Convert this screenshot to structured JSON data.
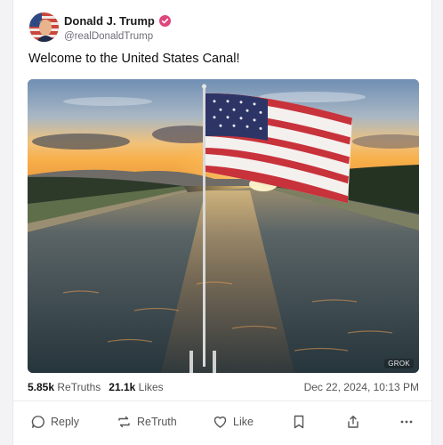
{
  "post": {
    "author_name": "Donald J. Trump",
    "author_handle": "@realDonaldTrump",
    "text": "Welcome to the United States Canal!",
    "media_badge": "GROK",
    "verified_color": "#e0457b"
  },
  "stats": {
    "retruths_count": "5.85k",
    "retruths_label": "ReTruths",
    "likes_count": "21.1k",
    "likes_label": "Likes",
    "date": "Dec 22, 2024, 10:13 PM"
  },
  "actions": {
    "reply_label": "Reply",
    "retruth_label": "ReTruth",
    "like_label": "Like",
    "bookmark_icon": "bookmark-icon",
    "share_icon": "share-icon",
    "more_icon": "more-icon"
  }
}
